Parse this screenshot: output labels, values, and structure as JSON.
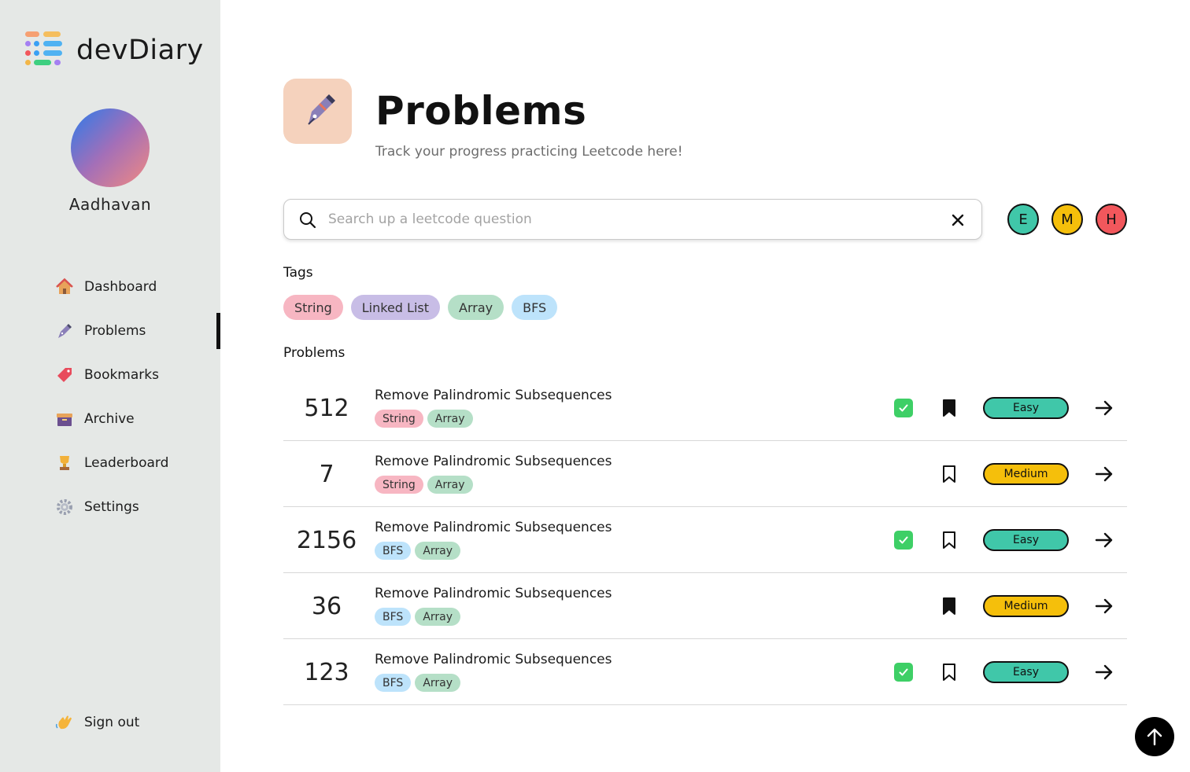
{
  "app": {
    "name": "devDiary"
  },
  "user": {
    "name": "Aadhavan"
  },
  "nav": {
    "items": [
      {
        "label": "Dashboard",
        "icon": "house-icon"
      },
      {
        "label": "Problems",
        "icon": "pen-icon",
        "active": true
      },
      {
        "label": "Bookmarks",
        "icon": "bookmark-tag-icon"
      },
      {
        "label": "Archive",
        "icon": "archive-box-icon"
      },
      {
        "label": "Leaderboard",
        "icon": "trophy-icon"
      },
      {
        "label": "Settings",
        "icon": "gear-icon"
      }
    ],
    "signout": {
      "label": "Sign out",
      "icon": "waving-hand-icon"
    }
  },
  "header": {
    "title": "Problems",
    "subtitle": "Track your progress practicing Leetcode here!",
    "icon": "fountain-pen-icon"
  },
  "search": {
    "placeholder": "Search up a leetcode question",
    "value": ""
  },
  "difficulty_filters": [
    {
      "label": "E",
      "color": "#40c7a9"
    },
    {
      "label": "M",
      "color": "#f5bf0b"
    },
    {
      "label": "H",
      "color": "#f2575c"
    }
  ],
  "tags_section": {
    "label": "Tags",
    "tags": [
      {
        "label": "String",
        "color": "#f7b6c2"
      },
      {
        "label": "Linked List",
        "color": "#c8bde6"
      },
      {
        "label": "Array",
        "color": "#b5dfc7"
      },
      {
        "label": "BFS",
        "color": "#bde3fb"
      }
    ]
  },
  "problems_section": {
    "label": "Problems",
    "rows": [
      {
        "number": "512",
        "title": "Remove Palindromic Subsequences",
        "tags": [
          "String",
          "Array"
        ],
        "completed": true,
        "bookmarked": true,
        "difficulty": "Easy"
      },
      {
        "number": "7",
        "title": "Remove Palindromic Subsequences",
        "tags": [
          "String",
          "Array"
        ],
        "completed": false,
        "bookmarked": false,
        "difficulty": "Medium"
      },
      {
        "number": "2156",
        "title": "Remove Palindromic Subsequences",
        "tags": [
          "BFS",
          "Array"
        ],
        "completed": true,
        "bookmarked": false,
        "difficulty": "Easy"
      },
      {
        "number": "36",
        "title": "Remove Palindromic Subsequences",
        "tags": [
          "BFS",
          "Array"
        ],
        "completed": false,
        "bookmarked": true,
        "difficulty": "Medium"
      },
      {
        "number": "123",
        "title": "Remove Palindromic Subsequences",
        "tags": [
          "BFS",
          "Array"
        ],
        "completed": true,
        "bookmarked": false,
        "difficulty": "Easy"
      }
    ]
  },
  "colors": {
    "sidebar_bg": "#e5e8e6",
    "easy": "#40c7a9",
    "medium": "#f5bf0b",
    "hard": "#f2575c",
    "check": "#3ecf66",
    "tag_String": "#f7b6c2",
    "tag_Linked List": "#c8bde6",
    "tag_Array": "#b5dfc7",
    "tag_BFS": "#bde3fb"
  }
}
